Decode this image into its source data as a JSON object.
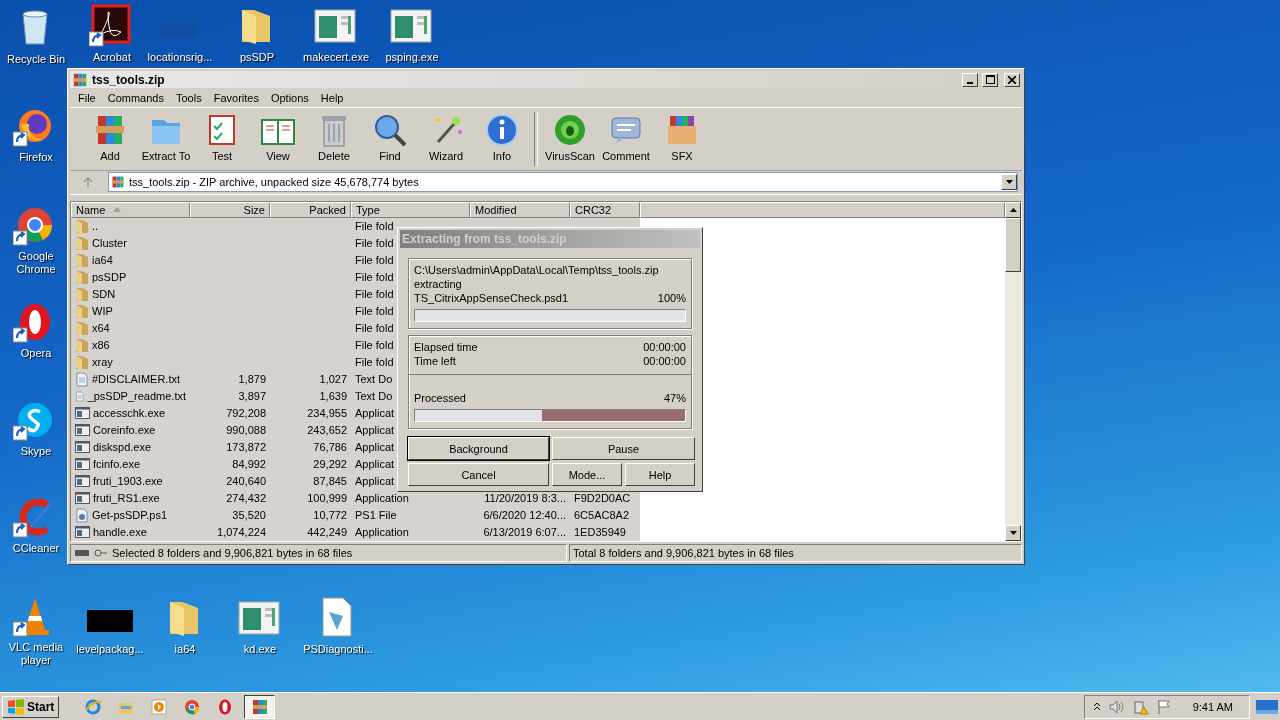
{
  "desktop_icons": [
    {
      "label": "Recycle Bin",
      "kind": "recycle",
      "shortcut": false
    },
    {
      "label": "Firefox",
      "kind": "firefox",
      "shortcut": true
    },
    {
      "label": "Google Chrome",
      "kind": "chrome",
      "shortcut": true
    },
    {
      "label": "Opera",
      "kind": "opera",
      "shortcut": true
    },
    {
      "label": "Skype",
      "kind": "skype",
      "shortcut": true
    },
    {
      "label": "CCleaner",
      "kind": "ccleaner",
      "shortcut": true
    },
    {
      "label": "VLC media player",
      "kind": "vlc",
      "shortcut": true
    },
    {
      "label": "Acrobat",
      "kind": "acrobat",
      "shortcut": true
    },
    {
      "label": "locationsrig...",
      "kind": "dark",
      "shortcut": false
    },
    {
      "label": "psSDP",
      "kind": "folder",
      "shortcut": false
    },
    {
      "label": "makecert.exe",
      "kind": "app",
      "shortcut": false
    },
    {
      "label": "psping.exe",
      "kind": "app",
      "shortcut": false
    },
    {
      "label": "levelpackag...",
      "kind": "black",
      "shortcut": false
    },
    {
      "label": "ia64",
      "kind": "folder",
      "shortcut": false
    },
    {
      "label": "kd.exe",
      "kind": "app",
      "shortcut": false
    },
    {
      "label": "PSDiagnosti...",
      "kind": "script",
      "shortcut": false
    }
  ],
  "window": {
    "title": "tss_tools.zip",
    "menu": [
      "File",
      "Commands",
      "Tools",
      "Favorites",
      "Options",
      "Help"
    ],
    "toolbar_groups": [
      {
        "buttons": [
          {
            "label": "Add",
            "kind": "add"
          },
          {
            "label": "Extract To",
            "kind": "extract"
          },
          {
            "label": "Test",
            "kind": "test"
          },
          {
            "label": "View",
            "kind": "view"
          },
          {
            "label": "Delete",
            "kind": "delete"
          },
          {
            "label": "Find",
            "kind": "find"
          },
          {
            "label": "Wizard",
            "kind": "wizard"
          },
          {
            "label": "Info",
            "kind": "info"
          }
        ]
      },
      {
        "buttons": [
          {
            "label": "VirusScan",
            "kind": "virus"
          },
          {
            "label": "Comment",
            "kind": "comment"
          },
          {
            "label": "SFX",
            "kind": "sfx"
          }
        ]
      }
    ],
    "address": "tss_tools.zip - ZIP archive, unpacked size 45,678,774 bytes",
    "table": {
      "columns": [
        {
          "label": "Name",
          "sorted": true
        },
        {
          "label": "Size",
          "sorted": false
        },
        {
          "label": "Packed",
          "sorted": false
        },
        {
          "label": "Type",
          "sorted": false
        },
        {
          "label": "Modified",
          "sorted": false
        },
        {
          "label": "CRC32",
          "sorted": false
        }
      ],
      "rows": [
        {
          "kind": "folder",
          "name": "..",
          "type": "File fold"
        },
        {
          "kind": "folder",
          "name": "Cluster",
          "type": "File fold"
        },
        {
          "kind": "folder",
          "name": "ia64",
          "type": "File fold"
        },
        {
          "kind": "folder",
          "name": "psSDP",
          "type": "File fold"
        },
        {
          "kind": "folder",
          "name": "SDN",
          "type": "File fold"
        },
        {
          "kind": "folder",
          "name": "WIP",
          "type": "File fold"
        },
        {
          "kind": "folder",
          "name": "x64",
          "type": "File fold"
        },
        {
          "kind": "folder",
          "name": "x86",
          "type": "File fold"
        },
        {
          "kind": "folder",
          "name": "xray",
          "type": "File fold"
        },
        {
          "kind": "text",
          "name": "#DISCLAIMER.txt",
          "size": "1,879",
          "packed": "1,027",
          "type": "Text Do"
        },
        {
          "kind": "text",
          "name": "_psSDP_readme.txt",
          "size": "3,897",
          "packed": "1,639",
          "type": "Text Do"
        },
        {
          "kind": "app",
          "name": "accesschk.exe",
          "size": "792,208",
          "packed": "234,955",
          "type": "Applicat"
        },
        {
          "kind": "app",
          "name": "Coreinfo.exe",
          "size": "990,088",
          "packed": "243,652",
          "type": "Applicat"
        },
        {
          "kind": "app",
          "name": "diskspd.exe",
          "size": "173,872",
          "packed": "76,786",
          "type": "Applicat"
        },
        {
          "kind": "app",
          "name": "fcinfo.exe",
          "size": "84,992",
          "packed": "29,292",
          "type": "Applicat"
        },
        {
          "kind": "app",
          "name": "fruti_1903.exe",
          "size": "240,640",
          "packed": "87,845",
          "type": "Applicat"
        },
        {
          "kind": "app",
          "name": "fruti_RS1.exe",
          "size": "274,432",
          "packed": "100,999",
          "type": "Application",
          "modified": "11/20/2019 8:3...",
          "crc": "F9D2D0AC"
        },
        {
          "kind": "script",
          "name": "Get-psSDP.ps1",
          "size": "35,520",
          "packed": "10,772",
          "type": "PS1 File",
          "modified": "6/6/2020 12:40...",
          "crc": "6C5AC8A2"
        },
        {
          "kind": "app",
          "name": "handle.exe",
          "size": "1,074,224",
          "packed": "442,249",
          "type": "Application",
          "modified": "6/13/2019 6:07...",
          "crc": "1ED35949"
        }
      ]
    },
    "status_left": "Selected 8 folders and 9,906,821 bytes in 68 files",
    "status_right": "Total 8 folders and 9,906,821 bytes in 68 files"
  },
  "dialog": {
    "title": "Extracting from tss_tools.zip",
    "path": "C:\\Users\\admin\\AppData\\Local\\Temp\\tss_tools.zip",
    "action": "extracting",
    "file": "TS_CitrixAppSenseCheck.psd1",
    "file_percent": "100%",
    "file_progress": {
      "level": 1
    },
    "elapsed_label": "Elapsed time",
    "elapsed": "00:00:00",
    "left_label": "Time left",
    "left": "00:00:00",
    "processed_label": "Processed",
    "processed_percent": "47%",
    "processed_progress": {
      "level": 0.47
    },
    "buttons": [
      {
        "label": "Background",
        "focused": true
      },
      {
        "label": "Pause",
        "focused": false
      },
      {
        "label": "Cancel",
        "focused": false
      },
      {
        "label": "Mode...",
        "focused": false
      },
      {
        "label": "Help",
        "focused": false
      }
    ]
  },
  "taskbar": {
    "start": "Start",
    "apps": [
      {
        "kind": "ie",
        "active": false
      },
      {
        "kind": "explorer",
        "active": false
      },
      {
        "kind": "media",
        "active": false
      },
      {
        "kind": "chrome",
        "active": false
      },
      {
        "kind": "opera",
        "active": false
      },
      {
        "kind": "winrar",
        "active": true
      }
    ],
    "tray": [
      {
        "kind": "chevron"
      },
      {
        "kind": "speaker"
      },
      {
        "kind": "network"
      },
      {
        "kind": "flag"
      }
    ],
    "clock": "9:41 AM"
  }
}
